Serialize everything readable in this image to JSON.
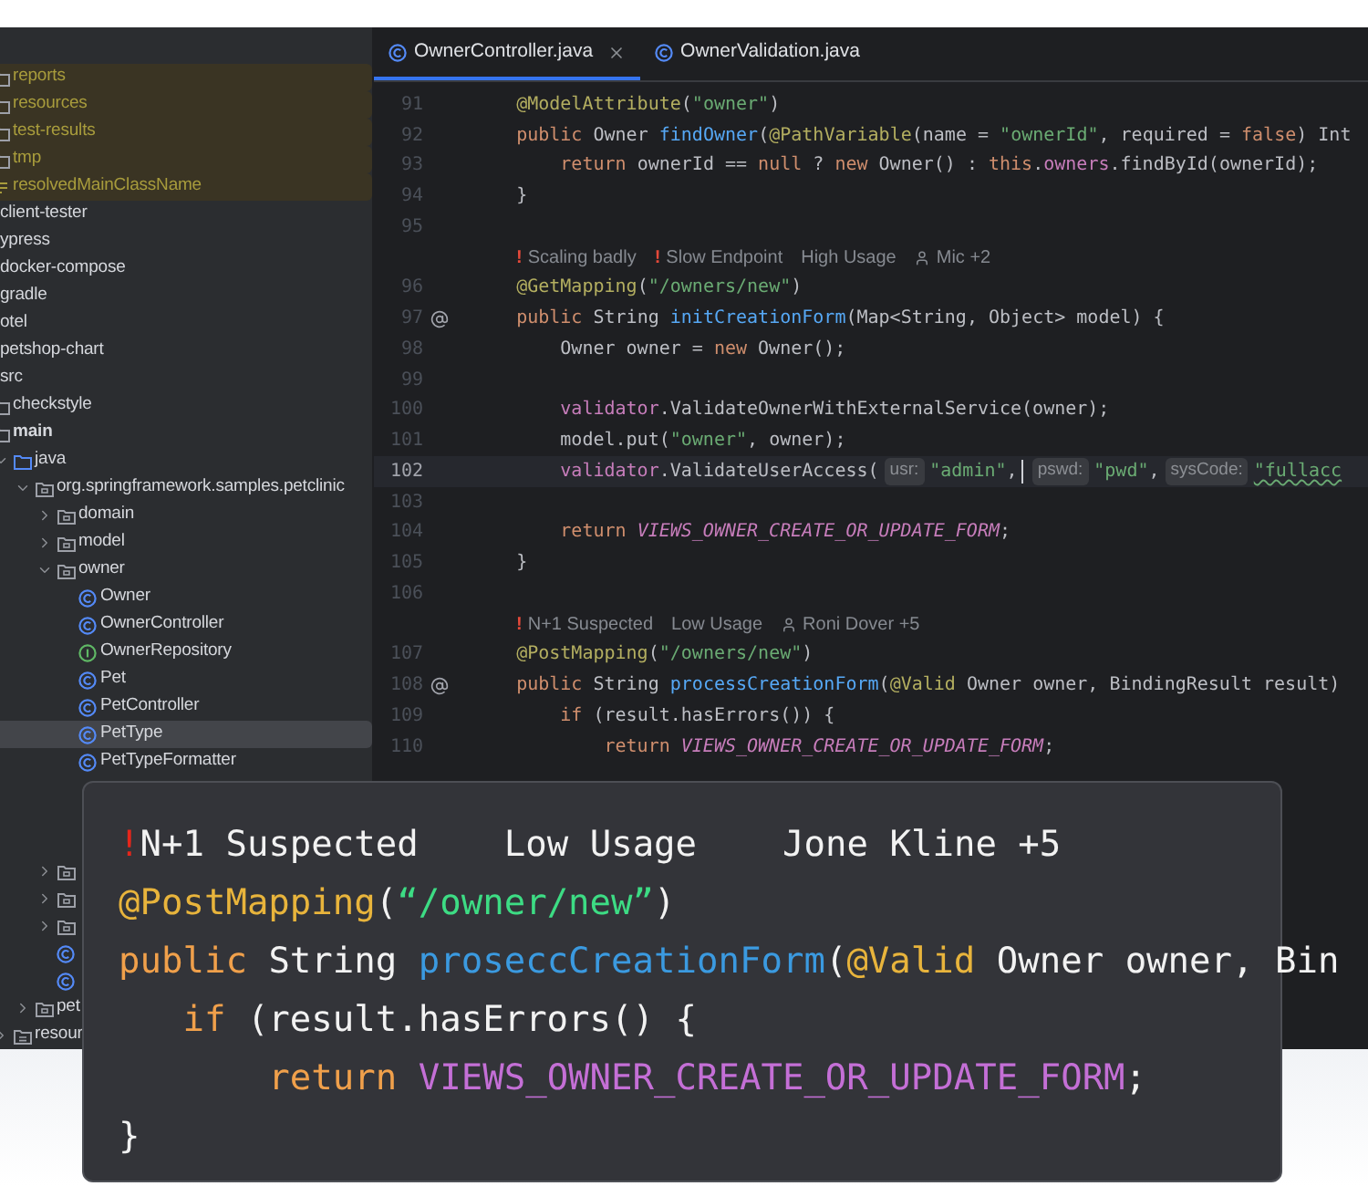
{
  "sidebar": {
    "build_items": [
      {
        "label": "reports",
        "kind": "folder",
        "excluded": true,
        "selected": false
      },
      {
        "label": "resources",
        "kind": "folder",
        "excluded": true,
        "selected": false
      },
      {
        "label": "test-results",
        "kind": "folder",
        "excluded": true,
        "selected": false
      },
      {
        "label": "tmp",
        "kind": "folder",
        "excluded": true,
        "selected": false
      },
      {
        "label": "resolvedMainClassName",
        "kind": "file",
        "excluded": true,
        "selected": false
      }
    ],
    "items": [
      {
        "label": "client-tester",
        "selected": false
      },
      {
        "label": "ypress",
        "selected": false
      },
      {
        "label": "docker-compose",
        "selected": false
      },
      {
        "label": "gradle",
        "selected": false
      },
      {
        "label": "otel",
        "selected": false
      },
      {
        "label": "petshop-chart",
        "selected": false
      },
      {
        "label": "src",
        "selected": false,
        "children": [
          {
            "label": "checkstyle",
            "kind": "folder",
            "selected": false
          },
          {
            "label": "main",
            "kind": "module",
            "selected": false,
            "children": [
              {
                "label": "java",
                "kind": "source",
                "selected": false,
                "expanded": true,
                "children": [
                  {
                    "label": "org.springframework.samples.petclinic",
                    "kind": "package",
                    "selected": false,
                    "expanded": true,
                    "children": [
                      {
                        "label": "domain",
                        "kind": "package",
                        "selected": false,
                        "expanded": false
                      },
                      {
                        "label": "model",
                        "kind": "package",
                        "selected": false,
                        "expanded": false
                      },
                      {
                        "label": "owner",
                        "kind": "package",
                        "selected": false,
                        "expanded": true,
                        "children": [
                          {
                            "label": "Owner",
                            "kind": "class",
                            "selected": false
                          },
                          {
                            "label": "OwnerController",
                            "kind": "class",
                            "selected": false
                          },
                          {
                            "label": "OwnerRepository",
                            "kind": "interface",
                            "selected": false
                          },
                          {
                            "label": "Pet",
                            "kind": "class",
                            "selected": false
                          },
                          {
                            "label": "PetController",
                            "kind": "class",
                            "selected": false
                          },
                          {
                            "label": "PetType",
                            "kind": "class",
                            "selected": true
                          },
                          {
                            "label": "PetTypeFormatter",
                            "kind": "class",
                            "selected": false
                          }
                        ]
                      },
                      {
                        "kind": "package",
                        "selected": false,
                        "expanded": false
                      },
                      {
                        "kind": "package",
                        "selected": false,
                        "expanded": false
                      },
                      {
                        "kind": "package",
                        "selected": false,
                        "expanded": false
                      },
                      {
                        "kind": "class",
                        "selected": false
                      },
                      {
                        "kind": "class",
                        "selected": false
                      }
                    ]
                  },
                  {
                    "label": "pet",
                    "kind": "package",
                    "selected": false,
                    "expanded": false
                  }
                ]
              },
              {
                "label": "resour",
                "kind": "resources",
                "selected": false,
                "expanded": false
              }
            ]
          }
        ]
      }
    ]
  },
  "tabs": [
    {
      "label": "OwnerController.java",
      "selected": true,
      "closable": true
    },
    {
      "label": "OwnerValidation.java",
      "selected": false,
      "closable": false
    }
  ],
  "editor": {
    "lines": [
      {
        "kind": "code",
        "number": "91",
        "current": false,
        "endpoint": false,
        "tokens": [
          {
            "text": "    @ModelAttribute",
            "kind": "ann"
          },
          {
            "text": "(",
            "kind": "plain"
          },
          {
            "text": "\"owner\"",
            "kind": "str"
          },
          {
            "text": ")",
            "kind": "plain"
          }
        ]
      },
      {
        "kind": "code",
        "number": "92",
        "current": false,
        "endpoint": false,
        "tokens": [
          {
            "text": "    public",
            "kind": "kw"
          },
          {
            "text": " Owner ",
            "kind": "plain"
          },
          {
            "text": "findOwner",
            "kind": "fn"
          },
          {
            "text": "(",
            "kind": "plain"
          },
          {
            "text": "@PathVariable",
            "kind": "ann"
          },
          {
            "text": "(name = ",
            "kind": "plain"
          },
          {
            "text": "\"ownerId\"",
            "kind": "str"
          },
          {
            "text": ", required = ",
            "kind": "plain"
          },
          {
            "text": "false",
            "kind": "kw"
          },
          {
            "text": ") Int",
            "kind": "plain"
          }
        ]
      },
      {
        "kind": "code",
        "number": "93",
        "current": false,
        "endpoint": false,
        "tokens": [
          {
            "text": "        return",
            "kind": "kw"
          },
          {
            "text": " ownerId == ",
            "kind": "plain"
          },
          {
            "text": "null",
            "kind": "kw"
          },
          {
            "text": " ? ",
            "kind": "plain"
          },
          {
            "text": "new",
            "kind": "kw"
          },
          {
            "text": " Owner() : ",
            "kind": "plain"
          },
          {
            "text": "this",
            "kind": "kw"
          },
          {
            "text": ".",
            "kind": "plain"
          },
          {
            "text": "owners",
            "kind": "field"
          },
          {
            "text": ".findById(ownerId);",
            "kind": "plain"
          }
        ]
      },
      {
        "kind": "code",
        "number": "94",
        "current": false,
        "endpoint": false,
        "tokens": [
          {
            "text": "    }",
            "kind": "plain"
          }
        ]
      },
      {
        "kind": "code",
        "number": "95",
        "current": false,
        "endpoint": false
      },
      {
        "kind": "lens",
        "items": [
          {
            "mark": "!",
            "label": "Scaling badly",
            "kind": "text"
          },
          {
            "mark": "!",
            "label": "Slow Endpoint",
            "kind": "text"
          },
          {
            "label": "High Usage",
            "kind": "text"
          },
          {
            "label": "Mic +2",
            "kind": "person"
          }
        ]
      },
      {
        "kind": "code",
        "number": "96",
        "current": false,
        "endpoint": false,
        "tokens": [
          {
            "text": "    @GetMapping",
            "kind": "ann"
          },
          {
            "text": "(",
            "kind": "plain"
          },
          {
            "text": "\"/owners/new\"",
            "kind": "str"
          },
          {
            "text": ")",
            "kind": "plain"
          }
        ]
      },
      {
        "kind": "code",
        "number": "97",
        "current": false,
        "endpoint": true,
        "tokens": [
          {
            "text": "    public",
            "kind": "kw"
          },
          {
            "text": " String ",
            "kind": "plain"
          },
          {
            "text": "initCreationForm",
            "kind": "fn"
          },
          {
            "text": "(Map<String, Object> model) {",
            "kind": "plain"
          }
        ]
      },
      {
        "kind": "code",
        "number": "98",
        "current": false,
        "endpoint": false,
        "tokens": [
          {
            "text": "        Owner owner = ",
            "kind": "plain"
          },
          {
            "text": "new",
            "kind": "kw"
          },
          {
            "text": " Owner();",
            "kind": "plain"
          }
        ]
      },
      {
        "kind": "code",
        "number": "99",
        "current": false,
        "endpoint": false
      },
      {
        "kind": "code",
        "number": "100",
        "current": false,
        "endpoint": false,
        "tokens": [
          {
            "text": "        validator",
            "kind": "field"
          },
          {
            "text": ".ValidateOwnerWithExternalService(owner);",
            "kind": "plain"
          }
        ]
      },
      {
        "kind": "code",
        "number": "101",
        "current": false,
        "endpoint": false,
        "tokens": [
          {
            "text": "        model.put(",
            "kind": "plain"
          },
          {
            "text": "\"owner\"",
            "kind": "str"
          },
          {
            "text": ", owner);",
            "kind": "plain"
          }
        ]
      },
      {
        "kind": "code",
        "number": "102",
        "current": true,
        "endpoint": false,
        "tokens": [
          {
            "text": "        validator",
            "kind": "field"
          },
          {
            "text": ".ValidateUserAccess(",
            "kind": "plain"
          },
          {
            "text": "usr:",
            "kind": "hint"
          },
          {
            "text": "\"admin\"",
            "kind": "str"
          },
          {
            "text": ",",
            "kind": "plain"
          },
          {
            "kind": "caret"
          },
          {
            "text": "pswd:",
            "kind": "hint"
          },
          {
            "text": "\"pwd\"",
            "kind": "str"
          },
          {
            "text": ",",
            "kind": "plain"
          },
          {
            "text": "sysCode:",
            "kind": "hint"
          },
          {
            "text": "\"fullacc",
            "kind": "str-warn"
          }
        ]
      },
      {
        "kind": "code",
        "number": "103",
        "current": false,
        "endpoint": false
      },
      {
        "kind": "code",
        "number": "104",
        "current": false,
        "endpoint": false,
        "tokens": [
          {
            "text": "        return ",
            "kind": "kw"
          },
          {
            "text": "VIEWS_OWNER_CREATE_OR_UPDATE_FORM",
            "kind": "const"
          },
          {
            "text": ";",
            "kind": "plain"
          }
        ]
      },
      {
        "kind": "code",
        "number": "105",
        "current": false,
        "endpoint": false,
        "tokens": [
          {
            "text": "    }",
            "kind": "plain"
          }
        ]
      },
      {
        "kind": "code",
        "number": "106",
        "current": false,
        "endpoint": false
      },
      {
        "kind": "lens",
        "items": [
          {
            "mark": "!",
            "label": "N+1 Suspected",
            "kind": "text"
          },
          {
            "label": "Low Usage",
            "kind": "text"
          },
          {
            "label": "Roni Dover +5",
            "kind": "person"
          }
        ]
      },
      {
        "kind": "code",
        "number": "107",
        "current": false,
        "endpoint": false,
        "tokens": [
          {
            "text": "    @PostMapping",
            "kind": "ann"
          },
          {
            "text": "(",
            "kind": "plain"
          },
          {
            "text": "\"/owners/new\"",
            "kind": "str"
          },
          {
            "text": ")",
            "kind": "plain"
          }
        ]
      },
      {
        "kind": "code",
        "number": "108",
        "current": false,
        "endpoint": true,
        "tokens": [
          {
            "text": "    public",
            "kind": "kw"
          },
          {
            "text": " String ",
            "kind": "plain"
          },
          {
            "text": "processCreationForm",
            "kind": "fn"
          },
          {
            "text": "(",
            "kind": "plain"
          },
          {
            "text": "@Valid",
            "kind": "ann"
          },
          {
            "text": " Owner owner, BindingResult result)",
            "kind": "plain"
          }
        ]
      },
      {
        "kind": "code",
        "number": "109",
        "current": false,
        "endpoint": false,
        "tokens": [
          {
            "text": "        if",
            "kind": "kw"
          },
          {
            "text": " (result.hasErrors()) {",
            "kind": "plain"
          }
        ]
      },
      {
        "kind": "code",
        "number": "110",
        "current": false,
        "endpoint": false,
        "tokens": [
          {
            "text": "            return ",
            "kind": "kw"
          },
          {
            "text": "VIEWS_OWNER_CREATE_OR_UPDATE_FORM",
            "kind": "const"
          },
          {
            "text": ";",
            "kind": "plain"
          }
        ]
      }
    ]
  },
  "callout": {
    "lens": [
      {
        "mark": "!",
        "label": "N+1 Suspected"
      },
      {
        "label": "Low Usage"
      },
      {
        "label": "Jone Kline +5"
      }
    ],
    "lines": [
      {
        "tokens": [
          {
            "text": "@PostMapping",
            "kind": "ann"
          },
          {
            "text": "(",
            "kind": "plain"
          },
          {
            "text": "“/owner/new”",
            "kind": "str"
          },
          {
            "text": ")",
            "kind": "plain"
          }
        ]
      },
      {
        "tokens": [
          {
            "text": "public",
            "kind": "kw"
          },
          {
            "text": " String ",
            "kind": "plain"
          },
          {
            "text": "proseccCreationForm",
            "kind": "fn"
          },
          {
            "text": "(",
            "kind": "plain"
          },
          {
            "text": "@Valid",
            "kind": "ann"
          },
          {
            "text": " Owner owner, Bin",
            "kind": "plain"
          }
        ]
      },
      {
        "tokens": [
          {
            "text": "   if",
            "kind": "kw"
          },
          {
            "text": " (result.hasErrors() {",
            "kind": "plain"
          }
        ]
      },
      {
        "tokens": [
          {
            "text": "       return ",
            "kind": "kw"
          },
          {
            "text": "VIEWS_OWNER_CREATE_OR_UPDATE_FORM",
            "kind": "const"
          },
          {
            "text": ";",
            "kind": "plain"
          }
        ]
      },
      {
        "tokens": [
          {
            "text": "}",
            "kind": "plain"
          }
        ]
      }
    ]
  }
}
